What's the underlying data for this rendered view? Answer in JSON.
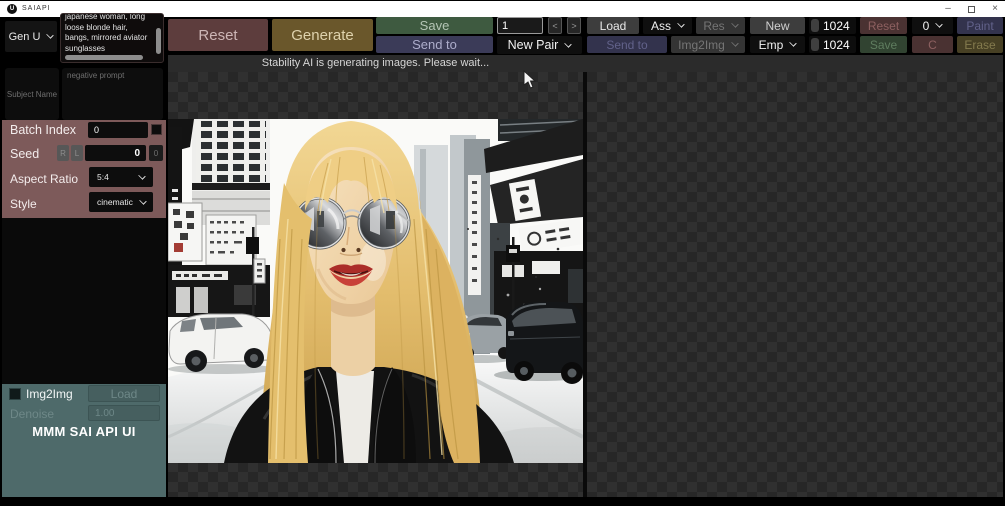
{
  "titlebar": {
    "title": "SAIAPI",
    "logo_letter": "U"
  },
  "icons": {
    "minimize": "–",
    "close": "×",
    "step_left": "<",
    "step_right": ">"
  },
  "toolbar": {
    "gen_menu": "Gen U",
    "prompt": "japanese woman, long loose blonde hair, bangs, mirrored aviator sunglasses",
    "reset": "Reset",
    "generate": "Generate",
    "save": "Save",
    "send_to": "Send to",
    "image_index": "1",
    "new_pair": "New Pair",
    "load": "Load",
    "ass_menu": "Ass",
    "res_menu": "Res",
    "send_to_2": "Send to",
    "img2img_menu": "Img2Img",
    "new": "New",
    "emp_menu": "Emp",
    "width": "1024",
    "height": "1024",
    "reset_2": "Reset",
    "save_2": "Save",
    "zero_menu": "0",
    "c": "C",
    "paint": "Paint",
    "erase": "Erase"
  },
  "status": {
    "message": "Stability AI is generating images. Please wait..."
  },
  "sidebar": {
    "subject_placeholder": "Subject Name",
    "negative_placeholder": "negative prompt",
    "batch_index_label": "Batch Index",
    "batch_index_value": "0",
    "seed_label": "Seed",
    "seed_r": "R",
    "seed_l": "L",
    "seed_value": "0",
    "seed_aux": "0",
    "aspect_label": "Aspect Ratio",
    "aspect_value": "5:4",
    "style_label": "Style",
    "style_value": "cinematic"
  },
  "img2img_panel": {
    "checkbox_label": "Img2Img",
    "load": "Load",
    "denoise_label": "Denoise",
    "denoise_value": "1.00",
    "app_title": "MMM SAI API UI"
  },
  "canvas": {
    "image_description": "black and white watercolor portrait of a japanese woman with long blonde hair, bangs and round mirrored sunglasses on a busy city street with cars and signs"
  },
  "colors": {
    "accent_maroon": "#7d5a5a",
    "button_red": "#5d3d3d",
    "button_yellow": "#6a572b",
    "button_green": "#3e5a40",
    "button_blue": "#3b3b58",
    "panel_teal": "#4e6a6a"
  }
}
